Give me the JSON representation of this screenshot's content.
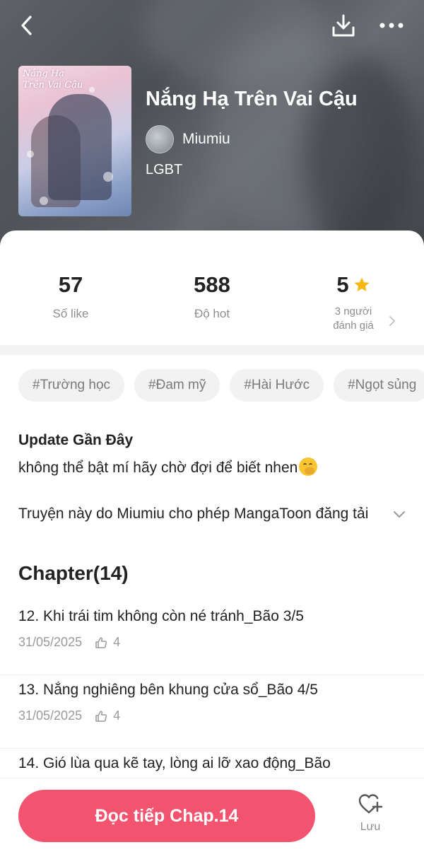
{
  "header": {
    "back_icon": "chevron-left-icon",
    "download_icon": "download-icon",
    "more_icon": "more-horizontal-icon"
  },
  "book": {
    "cover_title": "Nắng Hạ Trên Vai Cậu",
    "title": "Nắng Hạ Trên Vai Cậu",
    "author": "Miumiu",
    "genre": "LGBT"
  },
  "stats": {
    "likes": {
      "value": "57",
      "label": "Số like"
    },
    "hot": {
      "value": "588",
      "label": "Độ hot"
    },
    "rating": {
      "value": "5",
      "label_line1": "3 người",
      "label_line2": "đánh giá",
      "star_color": "#f5b90f"
    }
  },
  "tags": [
    "#Trường học",
    "#Đam mỹ",
    "#Hài Hước",
    "#Ngọt sủng"
  ],
  "update": {
    "heading": "Update Gần Đây",
    "text": "không thể bật mí hãy chờ đợi để biết nhen"
  },
  "permission_text": "Truyện này do  Miumiu  cho phép MangaToon đăng tải",
  "chapters": {
    "heading": "Chapter(14)",
    "items": [
      {
        "title": "12. Khi trái tim không còn né tránh_Bão 3/5",
        "date": "31/05/2025",
        "likes": "4"
      },
      {
        "title": "13. Nắng nghiêng bên khung cửa sổ_Bão 4/5",
        "date": "31/05/2025",
        "likes": "4"
      },
      {
        "title": "14. Gió lùa qua kẽ tay, lòng ai lỡ xao động_Bão",
        "date": "",
        "likes": ""
      }
    ]
  },
  "bottom": {
    "read_label": "Đọc tiếp Chap.14",
    "save_label": "Lưu",
    "accent_color": "#f2536f"
  }
}
